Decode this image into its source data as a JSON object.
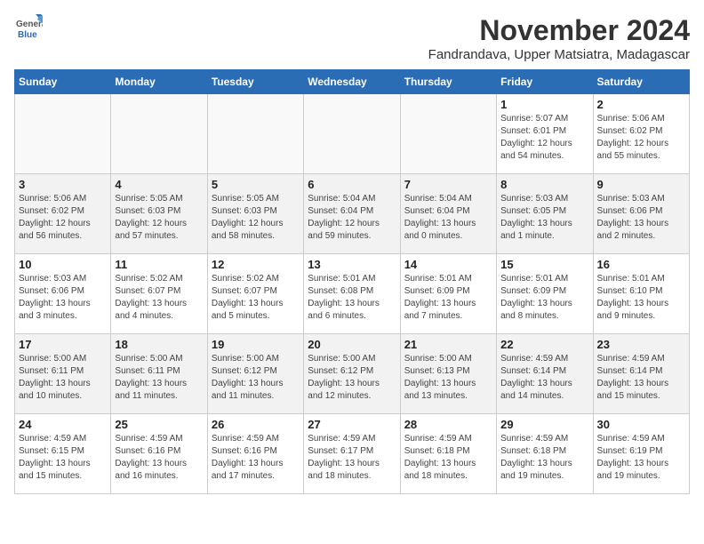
{
  "logo": {
    "text_general": "General",
    "text_blue": "Blue"
  },
  "title": "November 2024",
  "subtitle": "Fandrandava, Upper Matsiatra, Madagascar",
  "days_of_week": [
    "Sunday",
    "Monday",
    "Tuesday",
    "Wednesday",
    "Thursday",
    "Friday",
    "Saturday"
  ],
  "weeks": [
    [
      {
        "day": "",
        "info": ""
      },
      {
        "day": "",
        "info": ""
      },
      {
        "day": "",
        "info": ""
      },
      {
        "day": "",
        "info": ""
      },
      {
        "day": "",
        "info": ""
      },
      {
        "day": "1",
        "info": "Sunrise: 5:07 AM\nSunset: 6:01 PM\nDaylight: 12 hours\nand 54 minutes."
      },
      {
        "day": "2",
        "info": "Sunrise: 5:06 AM\nSunset: 6:02 PM\nDaylight: 12 hours\nand 55 minutes."
      }
    ],
    [
      {
        "day": "3",
        "info": "Sunrise: 5:06 AM\nSunset: 6:02 PM\nDaylight: 12 hours\nand 56 minutes."
      },
      {
        "day": "4",
        "info": "Sunrise: 5:05 AM\nSunset: 6:03 PM\nDaylight: 12 hours\nand 57 minutes."
      },
      {
        "day": "5",
        "info": "Sunrise: 5:05 AM\nSunset: 6:03 PM\nDaylight: 12 hours\nand 58 minutes."
      },
      {
        "day": "6",
        "info": "Sunrise: 5:04 AM\nSunset: 6:04 PM\nDaylight: 12 hours\nand 59 minutes."
      },
      {
        "day": "7",
        "info": "Sunrise: 5:04 AM\nSunset: 6:04 PM\nDaylight: 13 hours\nand 0 minutes."
      },
      {
        "day": "8",
        "info": "Sunrise: 5:03 AM\nSunset: 6:05 PM\nDaylight: 13 hours\nand 1 minute."
      },
      {
        "day": "9",
        "info": "Sunrise: 5:03 AM\nSunset: 6:06 PM\nDaylight: 13 hours\nand 2 minutes."
      }
    ],
    [
      {
        "day": "10",
        "info": "Sunrise: 5:03 AM\nSunset: 6:06 PM\nDaylight: 13 hours\nand 3 minutes."
      },
      {
        "day": "11",
        "info": "Sunrise: 5:02 AM\nSunset: 6:07 PM\nDaylight: 13 hours\nand 4 minutes."
      },
      {
        "day": "12",
        "info": "Sunrise: 5:02 AM\nSunset: 6:07 PM\nDaylight: 13 hours\nand 5 minutes."
      },
      {
        "day": "13",
        "info": "Sunrise: 5:01 AM\nSunset: 6:08 PM\nDaylight: 13 hours\nand 6 minutes."
      },
      {
        "day": "14",
        "info": "Sunrise: 5:01 AM\nSunset: 6:09 PM\nDaylight: 13 hours\nand 7 minutes."
      },
      {
        "day": "15",
        "info": "Sunrise: 5:01 AM\nSunset: 6:09 PM\nDaylight: 13 hours\nand 8 minutes."
      },
      {
        "day": "16",
        "info": "Sunrise: 5:01 AM\nSunset: 6:10 PM\nDaylight: 13 hours\nand 9 minutes."
      }
    ],
    [
      {
        "day": "17",
        "info": "Sunrise: 5:00 AM\nSunset: 6:11 PM\nDaylight: 13 hours\nand 10 minutes."
      },
      {
        "day": "18",
        "info": "Sunrise: 5:00 AM\nSunset: 6:11 PM\nDaylight: 13 hours\nand 11 minutes."
      },
      {
        "day": "19",
        "info": "Sunrise: 5:00 AM\nSunset: 6:12 PM\nDaylight: 13 hours\nand 11 minutes."
      },
      {
        "day": "20",
        "info": "Sunrise: 5:00 AM\nSunset: 6:12 PM\nDaylight: 13 hours\nand 12 minutes."
      },
      {
        "day": "21",
        "info": "Sunrise: 5:00 AM\nSunset: 6:13 PM\nDaylight: 13 hours\nand 13 minutes."
      },
      {
        "day": "22",
        "info": "Sunrise: 4:59 AM\nSunset: 6:14 PM\nDaylight: 13 hours\nand 14 minutes."
      },
      {
        "day": "23",
        "info": "Sunrise: 4:59 AM\nSunset: 6:14 PM\nDaylight: 13 hours\nand 15 minutes."
      }
    ],
    [
      {
        "day": "24",
        "info": "Sunrise: 4:59 AM\nSunset: 6:15 PM\nDaylight: 13 hours\nand 15 minutes."
      },
      {
        "day": "25",
        "info": "Sunrise: 4:59 AM\nSunset: 6:16 PM\nDaylight: 13 hours\nand 16 minutes."
      },
      {
        "day": "26",
        "info": "Sunrise: 4:59 AM\nSunset: 6:16 PM\nDaylight: 13 hours\nand 17 minutes."
      },
      {
        "day": "27",
        "info": "Sunrise: 4:59 AM\nSunset: 6:17 PM\nDaylight: 13 hours\nand 18 minutes."
      },
      {
        "day": "28",
        "info": "Sunrise: 4:59 AM\nSunset: 6:18 PM\nDaylight: 13 hours\nand 18 minutes."
      },
      {
        "day": "29",
        "info": "Sunrise: 4:59 AM\nSunset: 6:18 PM\nDaylight: 13 hours\nand 19 minutes."
      },
      {
        "day": "30",
        "info": "Sunrise: 4:59 AM\nSunset: 6:19 PM\nDaylight: 13 hours\nand 19 minutes."
      }
    ]
  ]
}
